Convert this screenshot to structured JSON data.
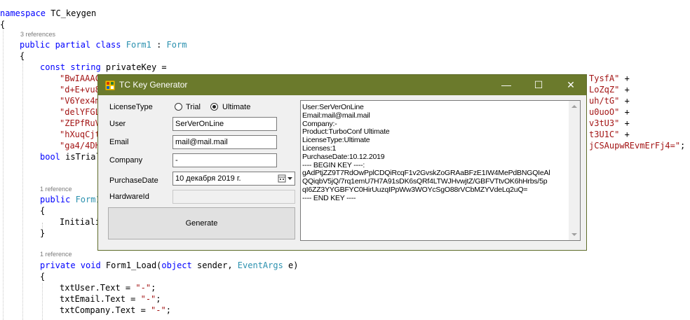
{
  "code": {
    "l1a": "namespace",
    "l1b": " TC_keygen",
    "l2": "{",
    "ref1": "3 references",
    "l3a": "public partial class",
    "l3b": " Form1",
    "l3c": " : ",
    "l3d": "Form",
    "l4": "{",
    "l5a": "const string",
    "l5b": " privateKey =",
    "l6a": "\"BwIAAAC",
    "l6b": "TysfA\"",
    "l6c": " +",
    "l7a": "\"d+E+vu8",
    "l7b": "LoZqZ\"",
    "l7c": " +",
    "l8a": "\"V6Yex4m",
    "l8b": "uh/tG\"",
    "l8c": " +",
    "l9a": "\"delYFGL",
    "l9b": "u0uoO\"",
    "l9c": " +",
    "l10a": "\"ZEPfRuV",
    "l10b": "v3tU3\"",
    "l10c": " +",
    "l11a": "\"hXuqCjt",
    "l11b": "t3U1C\"",
    "l11c": " +",
    "l12a": "\"ga4/4DH",
    "l12b": "jCSAupwREvmErFj4=\"",
    "l12c": ";",
    "l13a": "bool",
    "l13b": " isTrial",
    "ref2": "1 reference",
    "l14a": "public",
    "l14b": " Form1",
    "l15": "{",
    "l16": "Initiali",
    "l17": "}",
    "ref3": "1 reference",
    "l18a": "private void",
    "l18b": " Form1_Load(",
    "l18c": "object",
    "l18d": " sender, ",
    "l18e": "EventArgs",
    "l18f": " e)",
    "l19": "{",
    "l20a": "txtUser.Text = ",
    "l20b": "\"-\"",
    "l20c": ";",
    "l21a": "txtEmail.Text = ",
    "l21b": "\"-\"",
    "l21c": ";",
    "l22a": "txtCompany.Text = ",
    "l22b": "\"-\"",
    "l22c": ";"
  },
  "window": {
    "title": "TC Key Generator",
    "minimize": "—",
    "maximize": "☐",
    "close": "✕",
    "labels": {
      "license_type": "LicenseType",
      "user": "User",
      "email": "Email",
      "company": "Company",
      "purchase_date": "PurchaseDate",
      "hardware_id": "HardwareId"
    },
    "radio_trial": "Trial",
    "radio_ultimate": "Ultimate",
    "selected_license": "Ultimate",
    "user_value": "SerVerOnLine",
    "email_value": "mail@mail.mail",
    "company_value": "-",
    "date_value": "10 декабря  2019 г.",
    "hardware_value": "",
    "generate": "Generate",
    "output": "User:SerVerOnLine\nEmail:mail@mail.mail\nCompany:-\nProduct:TurboConf Ultimate\nLicenseType:Ultimate\nLicenses:1\nPurchaseDate:10.12.2019\n---- BEGIN KEY ----:\ngAdPtjZZ9T7RdOwPplCDQiRcqF1v2GvskZoGRAaBFzE1IW4MePdBNGQIeAl\nQQiqbV5jQ/7rq1emU7H7A91sDK6sQRf4LTWJHvwjtZ/GBFVTtvOK6hHrbs/5p\nqI6ZZ3YYGBFYC0HirUuzqIPpWw3WOYcSgO88rVCbMZYVdeLq2uQ=\n---- END KEY ----"
  },
  "colors": {
    "keyword": "#0000ff",
    "type": "#2b91af",
    "string": "#a31515",
    "titlebar": "#6b7a2c"
  }
}
